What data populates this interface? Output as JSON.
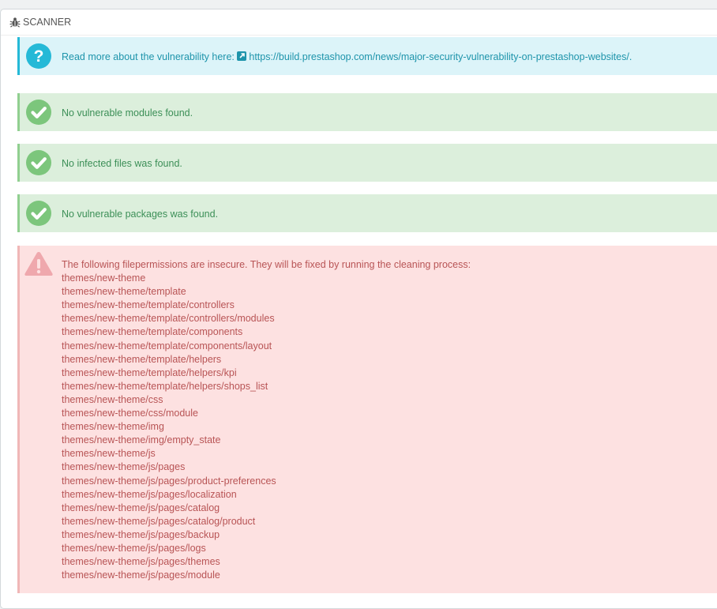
{
  "panel": {
    "title": "SCANNER",
    "title_icon": "bug-icon"
  },
  "info_alert": {
    "icon": "question-icon",
    "text": "Read more about the vulnerability here:",
    "link_icon": "external-link-icon",
    "link_text": "https://build.prestashop.com/news/major-security-vulnerability-on-prestashop-websites/",
    "suffix": "."
  },
  "success_alerts": [
    {
      "icon": "check-icon",
      "text": "No vulnerable modules found."
    },
    {
      "icon": "check-icon",
      "text": "No infected files was found."
    },
    {
      "icon": "check-icon",
      "text": "No vulnerable packages was found."
    }
  ],
  "danger_alert": {
    "icon": "warning-icon",
    "heading": "The following filepermissions are insecure. They will be fixed by running the cleaning process:",
    "paths": [
      "themes/new-theme",
      "themes/new-theme/template",
      "themes/new-theme/template/controllers",
      "themes/new-theme/template/controllers/modules",
      "themes/new-theme/template/components",
      "themes/new-theme/template/components/layout",
      "themes/new-theme/template/helpers",
      "themes/new-theme/template/helpers/kpi",
      "themes/new-theme/template/helpers/shops_list",
      "themes/new-theme/css",
      "themes/new-theme/css/module",
      "themes/new-theme/img",
      "themes/new-theme/img/empty_state",
      "themes/new-theme/js",
      "themes/new-theme/js/pages",
      "themes/new-theme/js/pages/product-preferences",
      "themes/new-theme/js/pages/localization",
      "themes/new-theme/js/pages/catalog",
      "themes/new-theme/js/pages/catalog/product",
      "themes/new-theme/js/pages/backup",
      "themes/new-theme/js/pages/logs",
      "themes/new-theme/js/pages/themes",
      "themes/new-theme/js/pages/module"
    ]
  },
  "colors": {
    "info_accent": "#25b9d7",
    "success_accent": "#91cf90",
    "danger_accent": "#f0b7b7"
  }
}
